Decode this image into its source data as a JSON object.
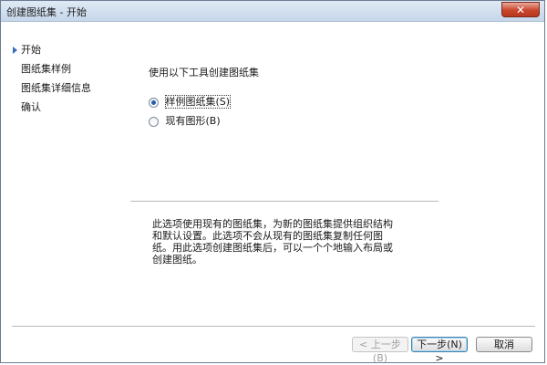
{
  "window": {
    "title": "创建图纸集 - 开始",
    "close_label": "✕"
  },
  "nav": {
    "items": [
      {
        "label": "开始",
        "active": true
      },
      {
        "label": "图纸集样例",
        "active": false
      },
      {
        "label": "图纸集详细信息",
        "active": false
      },
      {
        "label": "确认",
        "active": false
      }
    ]
  },
  "main": {
    "heading": "使用以下工具创建图纸集",
    "options": [
      {
        "label": "样例图纸集(S)",
        "selected": true
      },
      {
        "label": "现有图形(B)",
        "selected": false
      }
    ],
    "description": "此选项使用现有的图纸集，为新的图纸集提供组织结构和默认设置。此选项不会从现有的图纸集复制任何图纸。用此选项创建图纸集后，可以一个个地输入布局或创建图纸。"
  },
  "buttons": {
    "back": "< 上一步(B)",
    "next": "下一步(N) >",
    "cancel": "取消"
  }
}
